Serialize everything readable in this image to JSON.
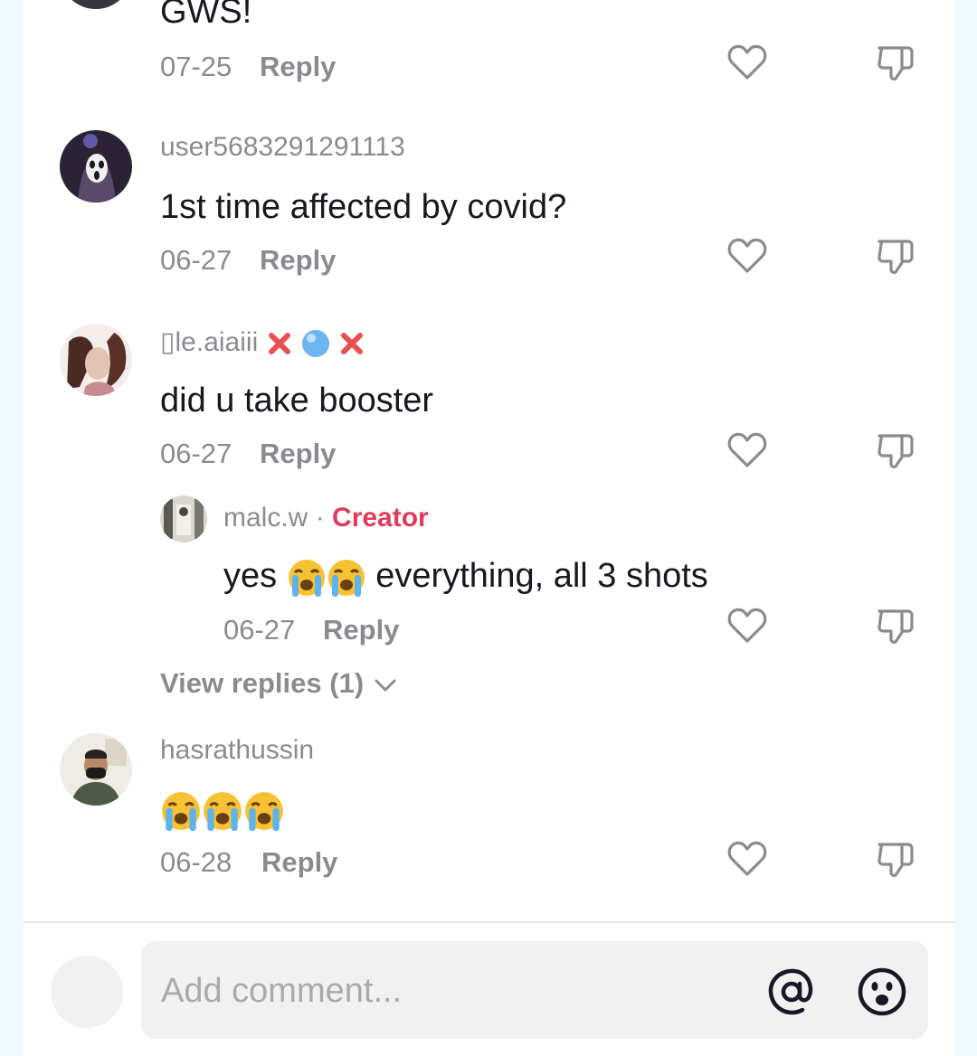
{
  "comments": [
    {
      "text": "GWS!",
      "date": "07-25",
      "reply_label": "Reply"
    },
    {
      "username": "user5683291291113",
      "text": "1st time affected by covid?",
      "date": "06-27",
      "reply_label": "Reply"
    },
    {
      "username": "le.aiaiii",
      "username_prefix_glyph": "▯",
      "text": "did u take booster",
      "date": "06-27",
      "reply_label": "Reply",
      "view_replies_label": "View replies (1)",
      "reply": {
        "username": "malc.w",
        "separator": "·",
        "badge": "Creator",
        "text_start": "yes",
        "text_end": "everything, all 3 shots",
        "date": "06-27",
        "reply_label": "Reply"
      }
    },
    {
      "username": "hasrathussin",
      "date": "06-28",
      "reply_label": "Reply"
    }
  ],
  "input": {
    "placeholder": "Add comment..."
  },
  "colors": {
    "creator": "#e03a5f",
    "muted": "#8a8b91",
    "text": "#161823"
  }
}
